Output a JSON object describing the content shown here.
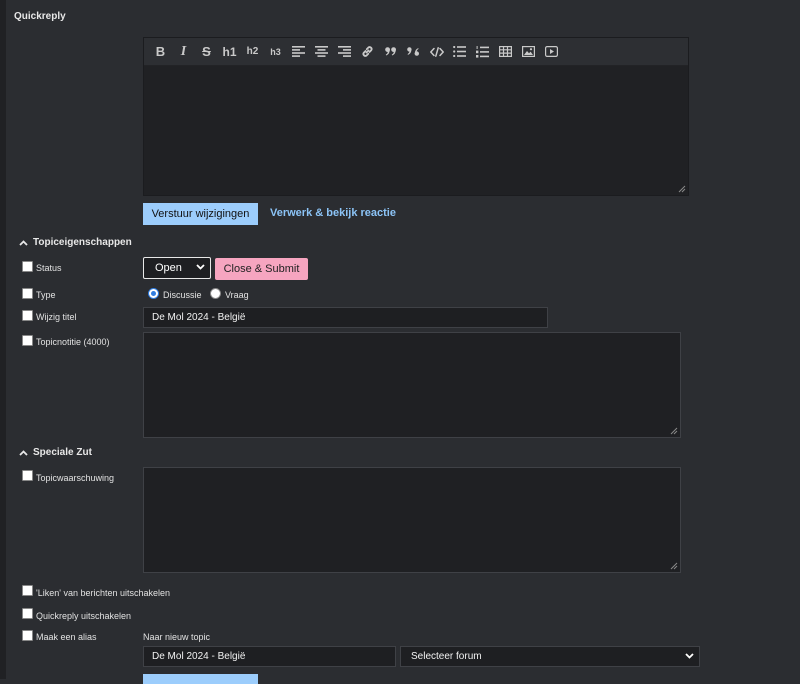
{
  "header": {
    "title": "Quickreply"
  },
  "editor": {
    "toolbar": [
      {
        "name": "bold-icon",
        "glyph": "B"
      },
      {
        "name": "italic-icon",
        "glyph": "I"
      },
      {
        "name": "strikethrough-icon",
        "glyph": "S"
      },
      {
        "name": "heading-1-icon",
        "glyph": "h1"
      },
      {
        "name": "heading-2-icon",
        "glyph": "h2"
      },
      {
        "name": "heading-3-icon",
        "glyph": "h3"
      },
      {
        "name": "align-left-icon",
        "glyph": ""
      },
      {
        "name": "align-center-icon",
        "glyph": ""
      },
      {
        "name": "align-right-icon",
        "glyph": ""
      },
      {
        "name": "link-icon",
        "glyph": ""
      },
      {
        "name": "quote-icon",
        "glyph": "”"
      },
      {
        "name": "quote-reply-icon",
        "glyph": ""
      },
      {
        "name": "code-icon",
        "glyph": "</>"
      },
      {
        "name": "bullet-list-icon",
        "glyph": ""
      },
      {
        "name": "numbered-list-icon",
        "glyph": ""
      },
      {
        "name": "table-icon",
        "glyph": ""
      },
      {
        "name": "image-icon",
        "glyph": ""
      },
      {
        "name": "video-icon",
        "glyph": ""
      }
    ],
    "value": ""
  },
  "actions": {
    "submit_label": "Verstuur wijzigingen",
    "preview_label": "Verwerk & bekijk reactie"
  },
  "topic_props": {
    "heading": "Topiceigenschappen",
    "status_label": "Status",
    "status_value": "Open",
    "close_submit_label": "Close & Submit",
    "type_label": "Type",
    "type_option_1": "Discussie",
    "type_option_2": "Vraag",
    "type_selected": "Discussie",
    "title_label": "Wijzig titel",
    "title_value": "De Mol 2024 - België",
    "note_label": "Topicnotitie (4000)",
    "note_value": ""
  },
  "special": {
    "heading": "Speciale Zut",
    "warning_label": "Topicwaarschuwing",
    "likes_label": "'Liken' van berichten uitschakelen",
    "quickreply_label": "Quickreply uitschakelen",
    "alias_label": "Maak een alias",
    "new_topic_label": "Naar nieuw topic",
    "alias_title_value": "De Mol 2024 - België",
    "forum_select_value": "Selecteer forum"
  },
  "colors": {
    "background": "#2b2d31",
    "primary_button": "#9ccdfc",
    "link": "#8cc4f7",
    "close_button": "#f6a5c0"
  }
}
